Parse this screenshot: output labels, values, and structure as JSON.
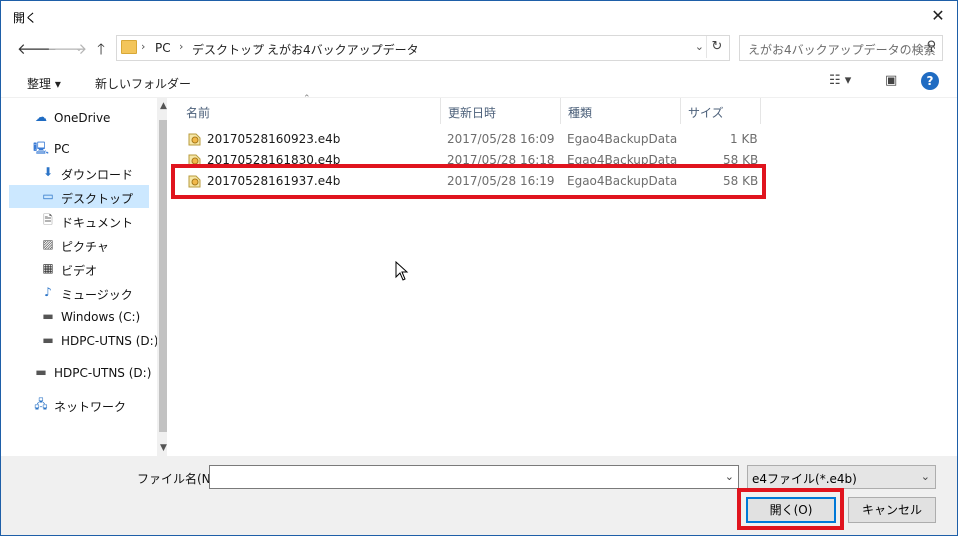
{
  "window": {
    "title": "開く",
    "close_glyph": "✕"
  },
  "nav": {
    "back_icon": "arrow-left-icon",
    "forward_icon": "arrow-right-icon",
    "up_icon": "arrow-up-icon",
    "breadcrumbs": [
      "PC",
      "デスクトップ",
      "えがお4バックアップデータ"
    ],
    "search_placeholder": "えがお4バックアップデータの検索"
  },
  "toolbar": {
    "organize_label": "整理 ▾",
    "new_folder_label": "新しいフォルダー"
  },
  "sidebar": {
    "items": [
      {
        "label": "OneDrive",
        "icon": "cloud-icon"
      },
      {
        "label": "PC",
        "icon": "computer-icon"
      },
      {
        "label": "ダウンロード",
        "icon": "download-icon"
      },
      {
        "label": "デスクトップ",
        "icon": "desktop-icon",
        "selected": true
      },
      {
        "label": "ドキュメント",
        "icon": "document-icon"
      },
      {
        "label": "ピクチャ",
        "icon": "picture-icon"
      },
      {
        "label": "ビデオ",
        "icon": "video-icon"
      },
      {
        "label": "ミュージック",
        "icon": "music-icon"
      },
      {
        "label": "Windows (C:)",
        "icon": "drive-icon"
      },
      {
        "label": "HDPC-UTNS (D:)",
        "icon": "drive-icon"
      },
      {
        "label": "HDPC-UTNS (D:)",
        "icon": "drive-icon"
      },
      {
        "label": "ネットワーク",
        "icon": "network-icon"
      }
    ]
  },
  "columns": {
    "name": "名前",
    "date": "更新日時",
    "type": "種類",
    "size": "サイズ"
  },
  "files": [
    {
      "name": "20170528160923.e4b",
      "date": "2017/05/28 16:09",
      "type": "Egao4BackupData",
      "size": "1 KB"
    },
    {
      "name": "20170528161830.e4b",
      "date": "2017/05/28 16:18",
      "type": "Egao4BackupData",
      "size": "58 KB"
    },
    {
      "name": "20170528161937.e4b",
      "date": "2017/05/28 16:19",
      "type": "Egao4BackupData",
      "size": "58 KB"
    }
  ],
  "bottom": {
    "filename_label": "ファイル名(N):",
    "filename_value": "",
    "filetype_value": "e4ファイル(*.e4b)",
    "open_label": "開く(O)",
    "cancel_label": "キャンセル"
  },
  "colors": {
    "highlight": "#e0141e",
    "accent": "#0078d7",
    "selected_bg": "#cce8ff"
  }
}
